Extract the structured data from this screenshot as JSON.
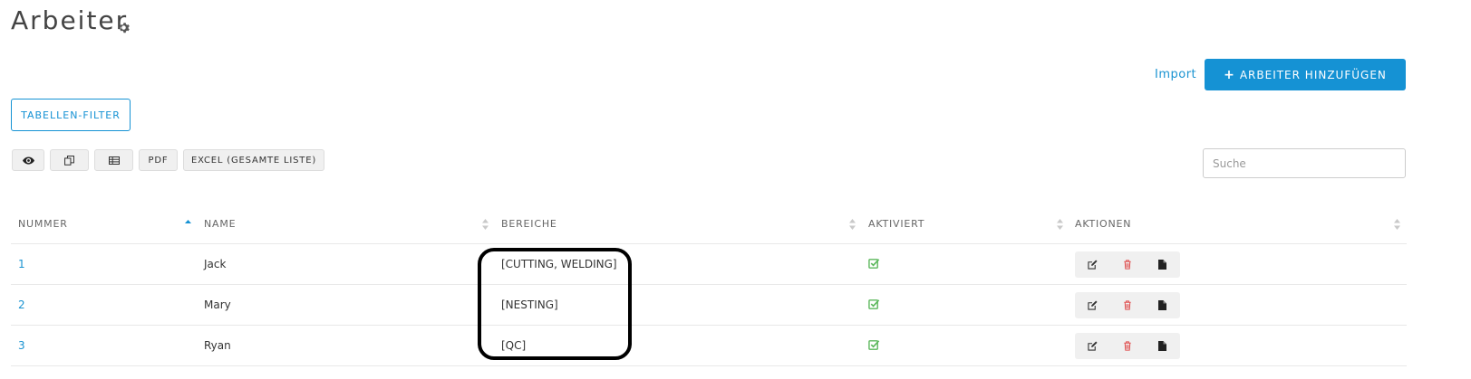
{
  "page": {
    "title": "Arbeiter"
  },
  "header": {
    "import_label": "Import",
    "add_button_label": "ARBEITER HINZUFÜGEN"
  },
  "filter": {
    "button_label": "TABELLEN-FILTER"
  },
  "toolbar": {
    "pdf_label": "PDF",
    "excel_label": "EXCEL (GESAMTE LISTE)"
  },
  "search": {
    "placeholder": "Suche",
    "value": ""
  },
  "table": {
    "columns": [
      "NUMMER",
      "NAME",
      "BEREICHE",
      "AKTIVIERT",
      "AKTIONEN"
    ],
    "sorted_column": "NUMMER",
    "sort_direction": "ascending",
    "rows": [
      {
        "number": "1",
        "name": "Jack",
        "areas": "[CUTTING, WELDING]",
        "active": true
      },
      {
        "number": "2",
        "name": "Mary",
        "areas": "[NESTING]",
        "active": true
      },
      {
        "number": "3",
        "name": "Ryan",
        "areas": "[QC]",
        "active": true
      }
    ]
  },
  "colors": {
    "accent": "#1592d4",
    "check": "#5cb85c",
    "delete": "#e05050"
  },
  "icons": [
    "gear-icon",
    "plus-icon",
    "eye-icon",
    "copy-icon",
    "csv-icon",
    "sort-asc-icon",
    "sort-icon",
    "check-icon",
    "edit-icon",
    "trash-icon",
    "file-icon"
  ]
}
